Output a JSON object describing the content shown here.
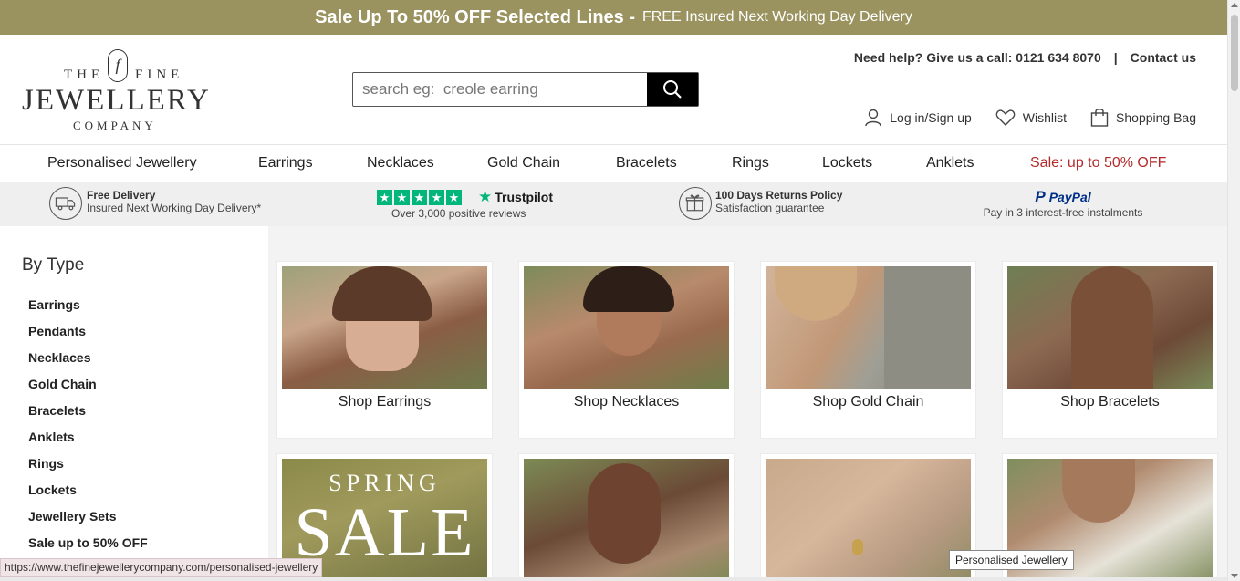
{
  "promo": {
    "headline": "Sale Up To 50% OFF Selected Lines -",
    "subline": "FREE Insured Next Working Day Delivery"
  },
  "logo": {
    "the": "THE",
    "fine": "FINE",
    "monogram": "f",
    "jewellery": "JEWELLERY",
    "company": "COMPANY"
  },
  "search": {
    "placeholder": "search eg:  creole earring",
    "value": ""
  },
  "help": {
    "phone_text": "Need help? Give us a call: 0121 634 8070",
    "separator": "|",
    "contact": "Contact us"
  },
  "account": {
    "login": "Log in/Sign up",
    "wishlist": "Wishlist",
    "bag": "Shopping Bag"
  },
  "nav": [
    "Personalised Jewellery",
    "Earrings",
    "Necklaces",
    "Gold Chain",
    "Bracelets",
    "Rings",
    "Lockets",
    "Anklets",
    "Sale: up to 50% OFF"
  ],
  "usp": {
    "delivery_title": "Free Delivery",
    "delivery_sub": "Insured Next Working Day Delivery*",
    "trustpilot_brand": "Trustpilot",
    "trustpilot_sub": "Over 3,000 positive reviews",
    "returns_title": "100 Days Returns Policy",
    "returns_sub": "Satisfaction guarantee",
    "paypal_brand": "PayPal",
    "paypal_sub": "Pay in 3 interest-free instalments"
  },
  "sidebar": {
    "heading": "By Type",
    "items": [
      "Earrings",
      "Pendants",
      "Necklaces",
      "Gold Chain",
      "Bracelets",
      "Anklets",
      "Rings",
      "Lockets",
      "Jewellery Sets",
      "Sale up to 50% OFF"
    ]
  },
  "cards": {
    "row1": [
      "Shop Earrings",
      "Shop Necklaces",
      "Shop Gold Chain",
      "Shop Bracelets"
    ],
    "spring_sale_top": "SPRING",
    "spring_sale_big": "SALE"
  },
  "status": {
    "url": "https://www.thefinejewellerycompany.com/personalised-jewellery"
  },
  "tooltip": {
    "text": "Personalised Jewellery"
  },
  "colors": {
    "promo_bg": "#9a935f",
    "sale_red": "#b22a2a",
    "trustpilot_green": "#00b67a",
    "paypal_blue": "#003087"
  }
}
